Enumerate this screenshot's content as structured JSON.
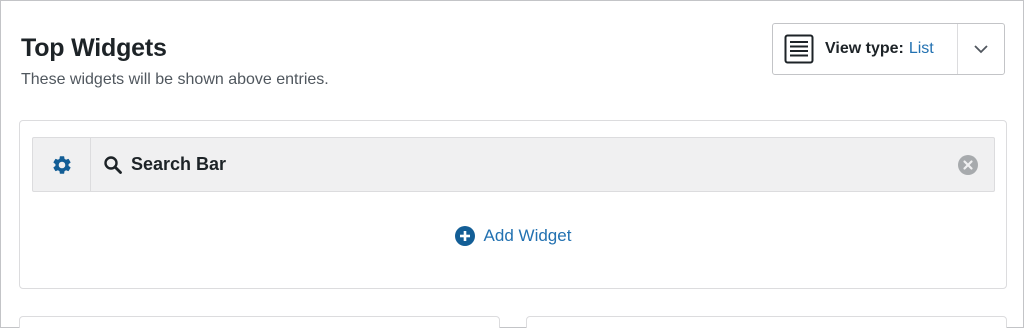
{
  "section": {
    "title": "Top Widgets",
    "subtitle": "These widgets will be shown above entries."
  },
  "view_type": {
    "label": "View type:",
    "value": "List",
    "icon": "list-icon",
    "toggle_icon": "chevron-down-icon"
  },
  "widgets": [
    {
      "name": "Search Bar",
      "icon": "search-icon",
      "settings_icon": "gear-icon",
      "remove_icon": "remove-circle-icon"
    }
  ],
  "add_widget": {
    "label": "Add Widget",
    "icon": "plus-circle-icon"
  },
  "colors": {
    "accent": "#2271b1",
    "gear": "#135e96",
    "text": "#1d2327",
    "muted": "#50575e",
    "border": "#dcdcde",
    "widget_bg": "#f0f0f1"
  }
}
